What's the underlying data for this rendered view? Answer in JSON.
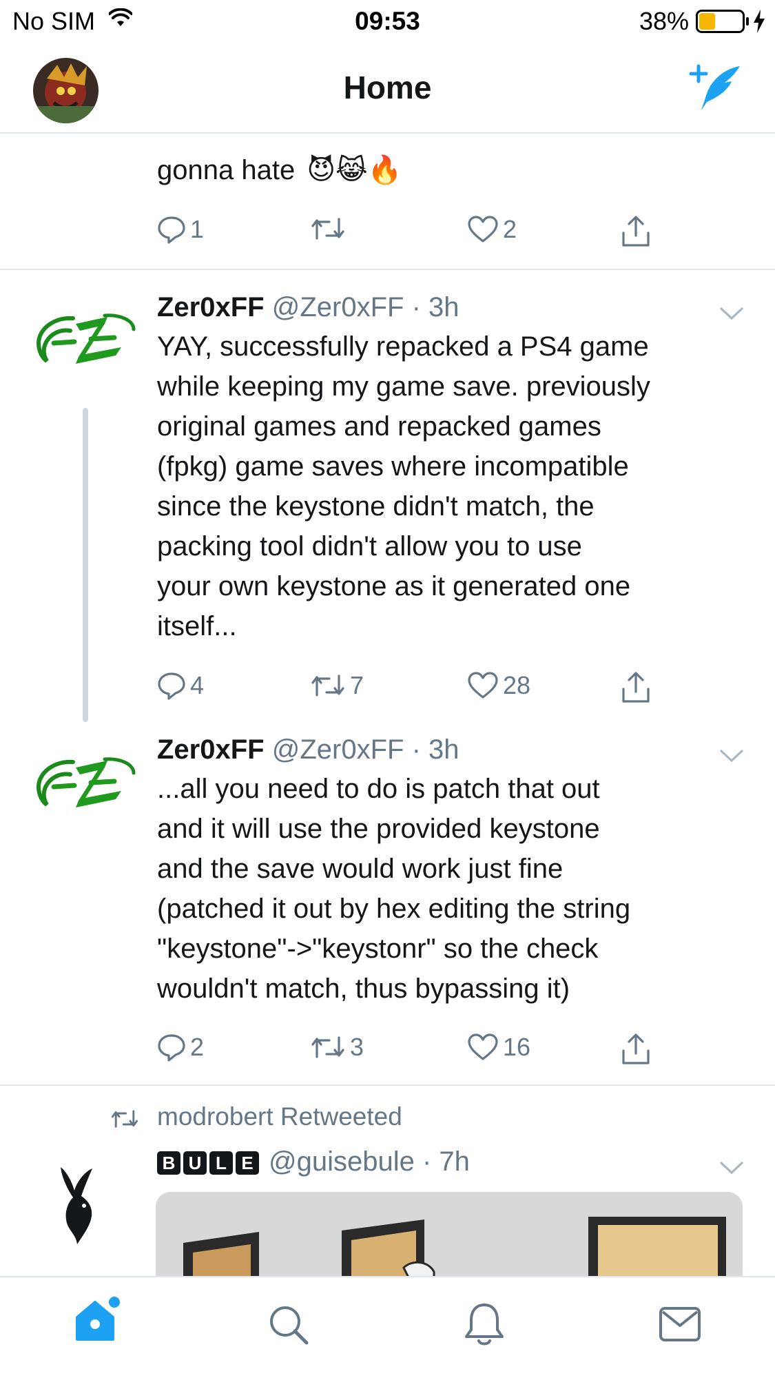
{
  "status_bar": {
    "carrier": "No SIM",
    "time": "09:53",
    "battery_percent": "38%",
    "battery_level": 0.38
  },
  "nav": {
    "title": "Home"
  },
  "colors": {
    "accent": "#1da1f2",
    "muted": "#657786",
    "text": "#14171a",
    "separator": "#e1e8ed",
    "battery": "#f5b700"
  },
  "tweet0": {
    "text": "gonna hate",
    "emoji": "😈😹🔥",
    "replies": "1",
    "retweets": "",
    "likes": "2"
  },
  "tweet1": {
    "name": "Zer0xFF",
    "handle": "@Zer0xFF",
    "time": "3h",
    "lines": [
      "YAY, successfully repacked a PS4 game",
      "while keeping my game save. previously",
      "original games and repacked games",
      "(fpkg) game saves where incompatible",
      "since the keystone didn't match, the",
      "packing tool didn't allow you to use",
      "your own keystone as it generated one",
      "itself..."
    ],
    "replies": "4",
    "retweets": "7",
    "likes": "28"
  },
  "tweet2": {
    "name": "Zer0xFF",
    "handle": "@Zer0xFF",
    "time": "3h",
    "lines": [
      "...all you need to do is patch that out",
      "and it will use the provided keystone",
      "and the save would work just fine",
      "(patched it out by hex editing the string",
      "\"keystone\"->\"keystonr\" so the check",
      "wouldn't match, thus bypassing it)"
    ],
    "replies": "2",
    "retweets": "3",
    "likes": "16"
  },
  "tweet3": {
    "retweeted_by": "modrobert Retweeted",
    "name_letters": [
      "B",
      "U",
      "L",
      "E"
    ],
    "handle": "@guisebule",
    "time": "7h"
  },
  "tabbar": {
    "items": [
      "home-icon",
      "search-icon",
      "notifications-icon",
      "messages-icon"
    ]
  }
}
